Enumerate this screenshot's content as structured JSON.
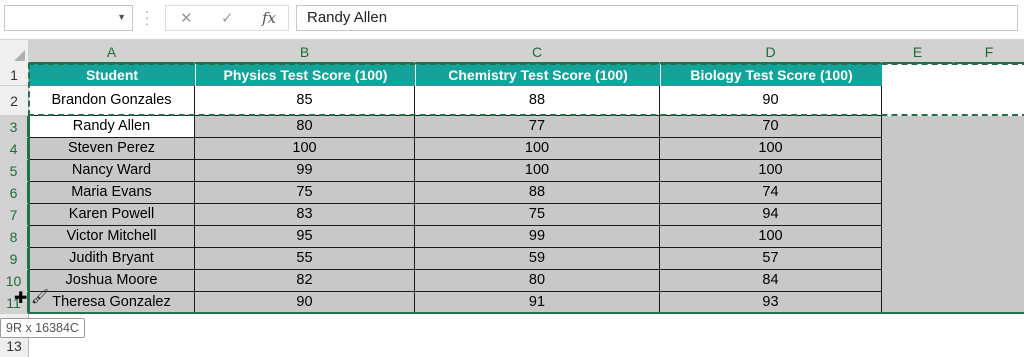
{
  "formula_bar": {
    "name_box": "",
    "value": "Randy Allen"
  },
  "columns": [
    "A",
    "B",
    "C",
    "D",
    "E",
    "F"
  ],
  "rows": [
    "1",
    "2",
    "3",
    "4",
    "5",
    "6",
    "7",
    "8",
    "9",
    "10",
    "11",
    "12",
    "13"
  ],
  "table": {
    "headers": [
      "Student",
      "Physics Test Score (100)",
      "Chemistry Test Score (100)",
      "Biology Test Score (100)"
    ],
    "data": [
      [
        "Brandon Gonzales",
        "85",
        "88",
        "90"
      ],
      [
        "Randy Allen",
        "80",
        "77",
        "70"
      ],
      [
        "Steven Perez",
        "100",
        "100",
        "100"
      ],
      [
        "Nancy Ward",
        "99",
        "100",
        "100"
      ],
      [
        "Maria Evans",
        "75",
        "88",
        "74"
      ],
      [
        "Karen Powell",
        "83",
        "75",
        "94"
      ],
      [
        "Victor Mitchell",
        "95",
        "99",
        "100"
      ],
      [
        "Judith Bryant",
        "55",
        "59",
        "57"
      ],
      [
        "Joshua Moore",
        "82",
        "80",
        "84"
      ],
      [
        "Theresa Gonzalez",
        "90",
        "91",
        "93"
      ]
    ]
  },
  "selection_tooltip": "9R x 16384C",
  "colors": {
    "header_fill": "#13a39a",
    "selected_fill": "#c8c8c8",
    "accent": "#217346"
  }
}
